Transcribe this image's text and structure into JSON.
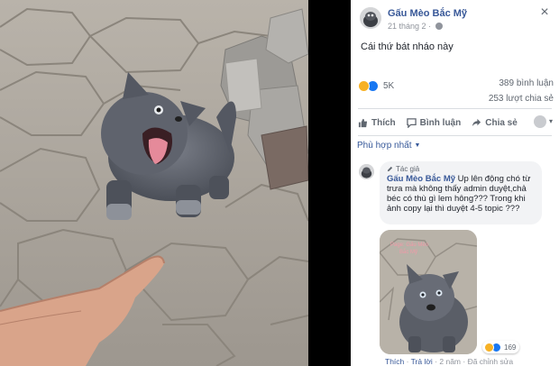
{
  "post": {
    "page_name": "Gấu Mèo Bắc Mỹ",
    "date": "21 tháng 2",
    "text": "Cái thứ bát nháo này",
    "close_symbol": "×",
    "reactions_count": "5K",
    "comments_count": "389 bình luận",
    "shares_count": "253 lượt chia sẻ"
  },
  "actions": {
    "like": "Thích",
    "comment": "Bình luận",
    "share": "Chia sẻ"
  },
  "comments_filter": "Phù hợp nhất",
  "comment": {
    "badge": "Tác giả",
    "author": "Gấu Mèo Bắc Mỹ",
    "text": " Up lên động chó từ trưa mà không thấy admin duyệt,chả béc có thù gì lem hông??? Trong khi ảnh copy lại thì duyệt 4-5 topic ???",
    "image_watermark_line1": "Page: Gấu Mèo",
    "image_watermark_line2": "Bắc Mỹ",
    "reaction_count": "169",
    "like": "Thích",
    "reply": "Trả lời",
    "time": "2 năm",
    "edited": "Đã chỉnh sửa"
  },
  "colors": {
    "link": "#385898",
    "haha": "#f7b125",
    "like": "#1877f2"
  }
}
